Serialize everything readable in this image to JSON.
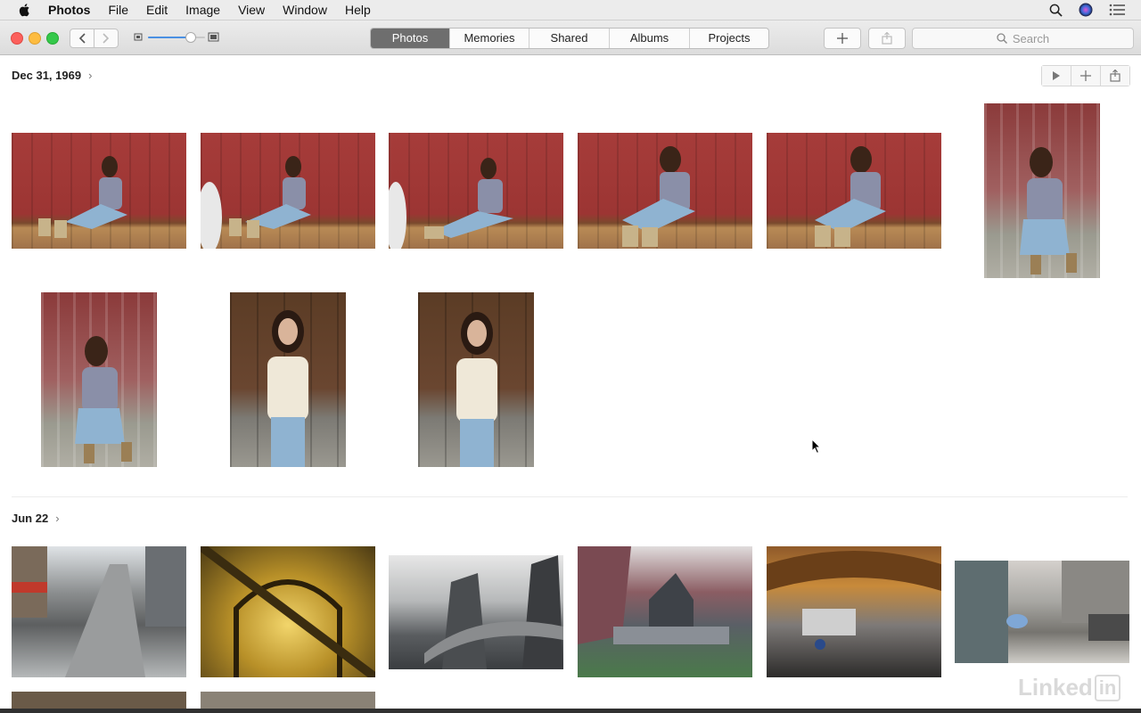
{
  "menubar": {
    "app": "Photos",
    "items": [
      "File",
      "Edit",
      "Image",
      "View",
      "Window",
      "Help"
    ]
  },
  "toolbar": {
    "tabs": [
      {
        "label": "Photos",
        "active": true
      },
      {
        "label": "Memories",
        "active": false
      },
      {
        "label": "Shared",
        "active": false
      },
      {
        "label": "Albums",
        "active": false
      },
      {
        "label": "Projects",
        "active": false
      }
    ],
    "search_placeholder": "Search",
    "zoom_level": 0.75
  },
  "sections": [
    {
      "title": "Dec 31, 1969"
    },
    {
      "title": "Jun 22"
    }
  ],
  "watermark": {
    "text": "Linked",
    "badge": "in"
  },
  "colors": {
    "accent": "#6e6e6e",
    "close": "#fc605c",
    "minimize": "#fdbc40",
    "zoom": "#34c84a"
  }
}
